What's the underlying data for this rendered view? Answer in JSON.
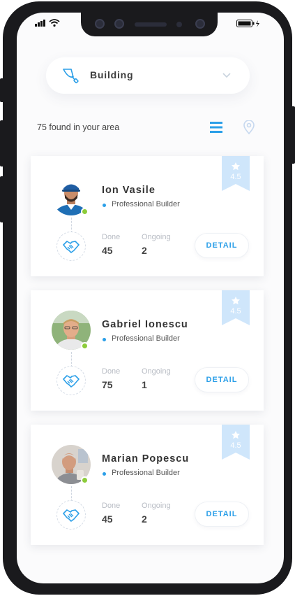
{
  "colors": {
    "accent": "#2b9fe8",
    "ribbon": "#cfe6fb",
    "online": "#8ccc3a"
  },
  "search": {
    "category": "Building",
    "icon": "trowel-icon"
  },
  "results": {
    "summary": "75 found in your area"
  },
  "builders": [
    {
      "name": "Ion Vasile",
      "role": "Professional Builder",
      "rating": "4.5",
      "done_label": "Done",
      "done": "45",
      "ongoing_label": "Ongoing",
      "ongoing": "2",
      "action": "DETAIL",
      "online": true
    },
    {
      "name": "Gabriel Ionescu",
      "role": "Professional Builder",
      "rating": "4.5",
      "done_label": "Done",
      "done": "75",
      "ongoing_label": "Ongoing",
      "ongoing": "1",
      "action": "DETAIL",
      "online": true
    },
    {
      "name": "Marian Popescu",
      "role": "Professional Builder",
      "rating": "4.5",
      "done_label": "Done",
      "done": "45",
      "ongoing_label": "Ongoing",
      "ongoing": "2",
      "action": "DETAIL",
      "online": true
    }
  ]
}
